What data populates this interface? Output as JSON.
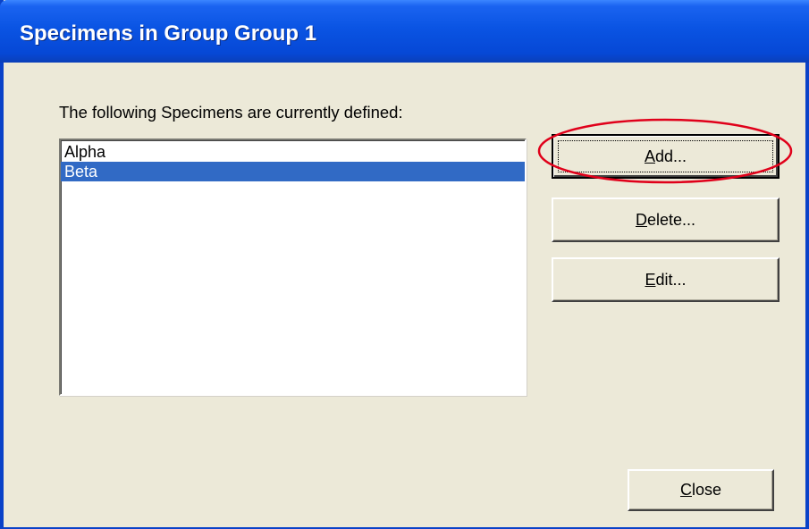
{
  "window": {
    "title": "Specimens in Group Group 1"
  },
  "dialog": {
    "caption": "The following Specimens are currently defined:",
    "specimens": [
      {
        "label": "Alpha",
        "selected": false
      },
      {
        "label": "Beta",
        "selected": true
      }
    ]
  },
  "buttons": {
    "add": {
      "mnemonic": "A",
      "rest": "dd..."
    },
    "delete": {
      "mnemonic": "D",
      "rest": "elete..."
    },
    "edit": {
      "mnemonic": "E",
      "rest": "dit..."
    },
    "close": {
      "mnemonic": "C",
      "rest": "lose"
    }
  },
  "colors": {
    "titlebar": "#0a54e3",
    "dialog_bg": "#ece9d8",
    "selection": "#316ac5",
    "annotation": "#e0001a"
  }
}
